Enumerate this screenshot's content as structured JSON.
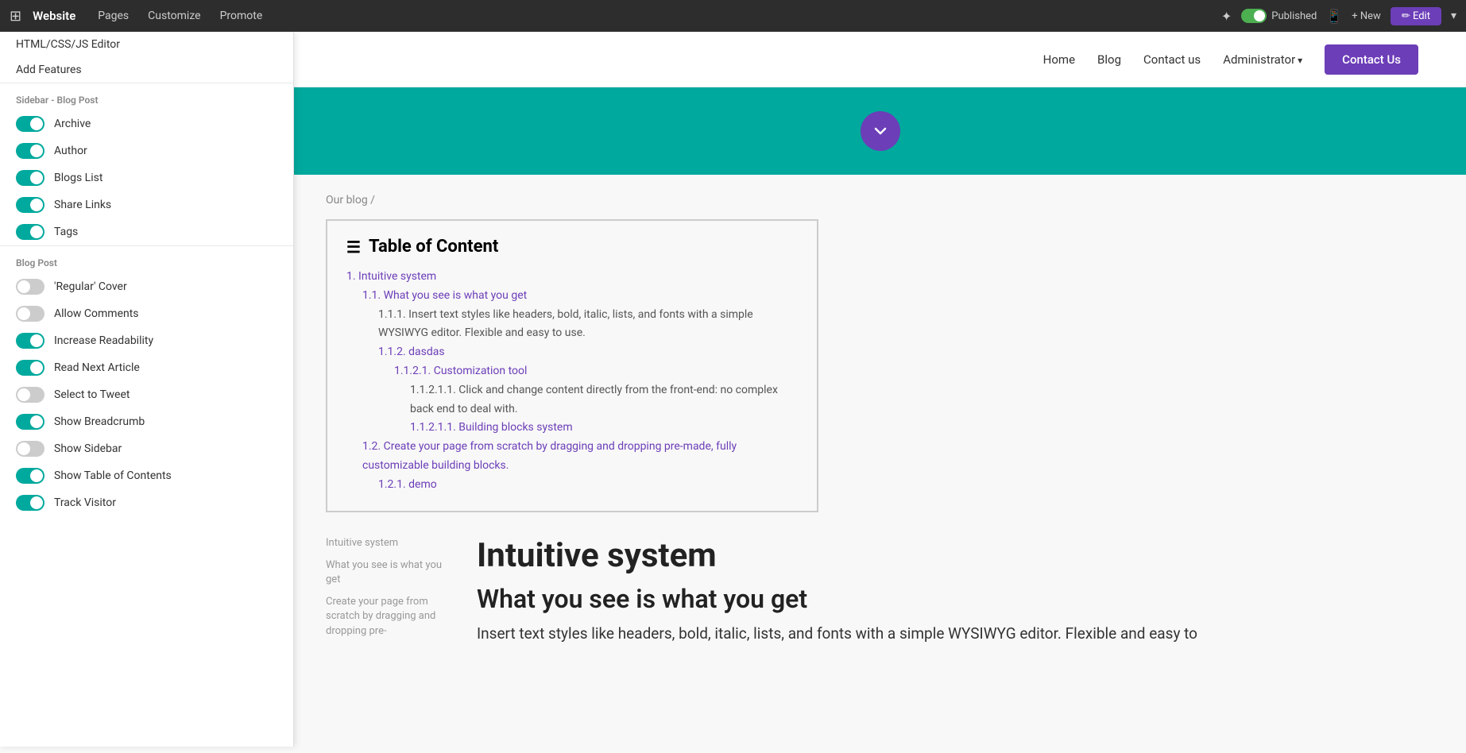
{
  "topbar": {
    "brand": "Website",
    "nav_items": [
      "Pages",
      "Customize",
      "Promote"
    ],
    "published_label": "Published",
    "new_label": "+ New",
    "edit_label": "✏ Edit"
  },
  "sidebar_menu": {
    "items": [
      {
        "label": "HTML/CSS/JS Editor"
      },
      {
        "label": "Add Features"
      }
    ]
  },
  "sidebar_blog_post_section": {
    "label": "Sidebar - Blog Post",
    "toggles": [
      {
        "label": "Archive",
        "on": true
      },
      {
        "label": "Author",
        "on": true
      },
      {
        "label": "Blogs List",
        "on": true
      },
      {
        "label": "Share Links",
        "on": true
      },
      {
        "label": "Tags",
        "on": true
      }
    ]
  },
  "sidebar_blog_post_section2": {
    "label": "Blog Post",
    "toggles": [
      {
        "label": "'Regular' Cover",
        "on": false
      },
      {
        "label": "Allow Comments",
        "on": false
      },
      {
        "label": "Increase Readability",
        "on": true
      },
      {
        "label": "Read Next Article",
        "on": true
      },
      {
        "label": "Select to Tweet",
        "on": false
      },
      {
        "label": "Show Breadcrumb",
        "on": true
      },
      {
        "label": "Show Sidebar",
        "on": false
      },
      {
        "label": "Show Table of Contents",
        "on": true
      },
      {
        "label": "Track Visitor",
        "on": true
      }
    ]
  },
  "site_nav": {
    "links": [
      "Home",
      "Blog",
      "Contact us",
      "Administrator"
    ],
    "has_dropdown": [
      false,
      false,
      false,
      true
    ],
    "cta_label": "Contact Us"
  },
  "breadcrumb": {
    "items": [
      "Our blog",
      "/"
    ]
  },
  "toc": {
    "title": "Table of Content",
    "items": [
      {
        "level": 1,
        "text": "1. Intuitive system",
        "link": true
      },
      {
        "level": 2,
        "text": "1.1. What you see is what you get",
        "link": true
      },
      {
        "level": 3,
        "text": "1.1.1. Insert text styles like headers, bold, italic, lists, and fonts with a simple WYSIWYG editor. Flexible and easy to use.",
        "link": false
      },
      {
        "level": 3,
        "text": "1.1.2. dasdas",
        "link": true
      },
      {
        "level": 4,
        "text": "1.1.2.1. Customization tool",
        "link": true
      },
      {
        "level": 5,
        "text": "1.1.2.1.1. Click and change content directly from the front-end: no complex back end to deal with.",
        "link": false
      },
      {
        "level": 5,
        "text": "1.1.2.1.1. Building blocks system",
        "link": true
      },
      {
        "level": 2,
        "text": "1.2. Create your page from scratch by dragging and dropping pre-made, fully customizable building blocks.",
        "link": true
      },
      {
        "level": 3,
        "text": "1.2.1. demo",
        "link": true
      }
    ]
  },
  "article": {
    "toc_items": [
      "Intuitive system",
      "What you see is what you get",
      "Create your page from scratch by dragging and dropping pre-"
    ],
    "h1": "Intuitive system",
    "h2": "What you see is what you get",
    "body": "Insert text styles like headers, bold, italic, lists, and fonts with a simple WYSIWYG editor. Flexible and easy to"
  }
}
